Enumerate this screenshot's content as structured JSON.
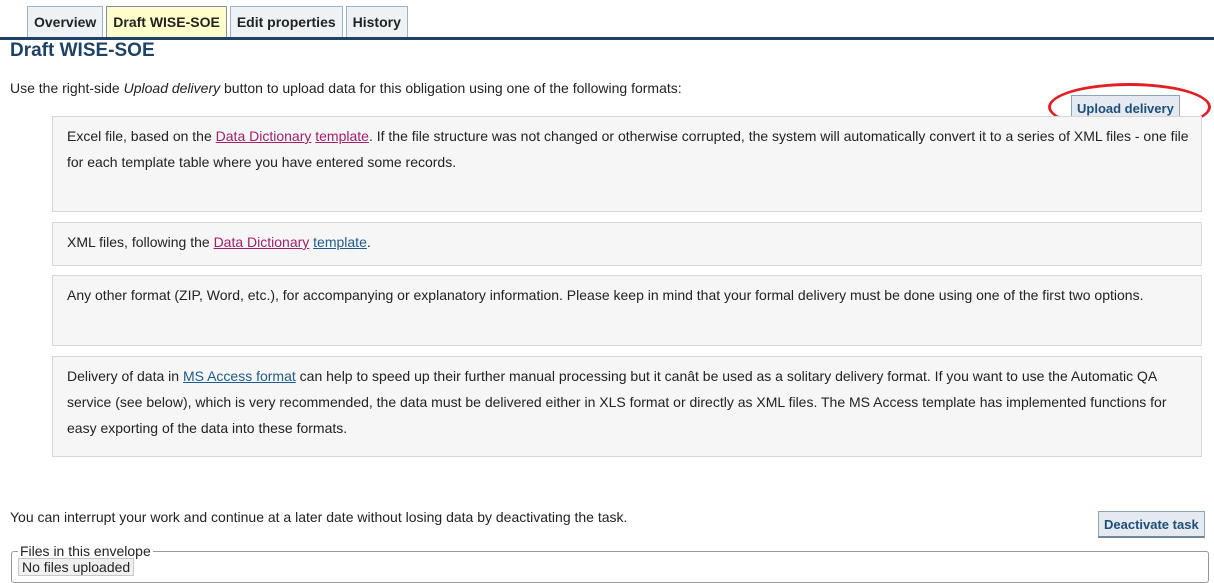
{
  "tabs": [
    "Overview",
    "Draft WISE-SOE",
    "Edit properties",
    "History"
  ],
  "page_title": "Draft WISE-SOE",
  "intro": {
    "before": "Use the right-side ",
    "emph": "Upload delivery",
    "after": " button to upload data for this obligation using one of the following formats:"
  },
  "upload_button": "Upload delivery",
  "formats": {
    "excel": {
      "pre": "Excel file, based on the ",
      "link1": "Data Dictionary",
      "mid": " ",
      "link2": "template",
      "post": ". If the file structure was not changed or otherwise corrupted, the system will automatically convert it to a series of XML files - one file for each template table where you have entered some records."
    },
    "xml": {
      "pre": "XML files, following the ",
      "link1": "Data Dictionary",
      "mid": " ",
      "link2": "template",
      "post": "."
    },
    "other": "Any other format (ZIP, Word, etc.), for accompanying or explanatory information. Please keep in mind that your formal delivery must be done using one of the first two options.",
    "access": {
      "pre": "Delivery of data in ",
      "link": "MS Access format",
      "post": " can help to speed up their further manual processing but it canât be used as a solitary delivery format. If you want to use the Automatic QA service (see below), which is very recommended, the data must be delivered either in XLS format or directly as XML files. The MS Access template has implemented functions for easy exporting of the data into these formats."
    }
  },
  "interrupt_text": "You can interrupt your work and continue at a later date without losing data by deactivating the task.",
  "deactivate_button": "Deactivate task",
  "files": {
    "legend": "Files in this envelope",
    "empty": "No files uploaded"
  },
  "colors": {
    "accent": "#1d4264",
    "active_tab": "#ffffcc",
    "highlight_ring": "#e31e24",
    "dd_link": "#a0206a",
    "link": "#1f5a8a"
  }
}
